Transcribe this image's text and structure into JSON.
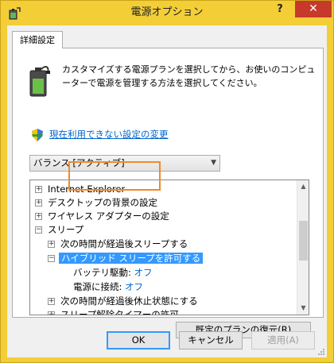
{
  "window": {
    "title": "電源オプション",
    "help_label": "?",
    "close_label": "✕"
  },
  "tab": {
    "label": "詳細設定"
  },
  "description": "カスタマイズする電源プランを選択してから、お使いのコンピューターで電源を管理する方法を選択してください。",
  "link": {
    "label": "現在利用できない設定の変更"
  },
  "plan_select": {
    "value": "バランス [アクティブ]"
  },
  "tree": {
    "items": [
      {
        "expander": "+",
        "label": "Internet Explorer"
      },
      {
        "expander": "+",
        "label": "デスクトップの背景の設定"
      },
      {
        "expander": "+",
        "label": "ワイヤレス アダプターの設定"
      },
      {
        "expander": "−",
        "label": "スリープ"
      },
      {
        "expander": "+",
        "label": "次の時間が経過後スリープする"
      },
      {
        "expander": "−",
        "label": "ハイブリッド スリープを許可する"
      },
      {
        "label": "バッテリ駆動:",
        "value": "オフ"
      },
      {
        "label": "電源に接続:",
        "value": "オフ"
      },
      {
        "expander": "+",
        "label": "次の時間が経過後休止状態にする"
      },
      {
        "expander": "+",
        "label": "スリープ解除タイマーの許可"
      }
    ]
  },
  "restore_button": {
    "label": "既定のプランの復元(R)"
  },
  "buttons": {
    "ok": "OK",
    "cancel": "キャンセル",
    "apply": "適用(A)"
  },
  "colors": {
    "title_bar": "#f3ce37",
    "close_button": "#c7392b",
    "selection": "#3399ff",
    "highlight": "#f08a2a",
    "link": "#0066cc"
  }
}
